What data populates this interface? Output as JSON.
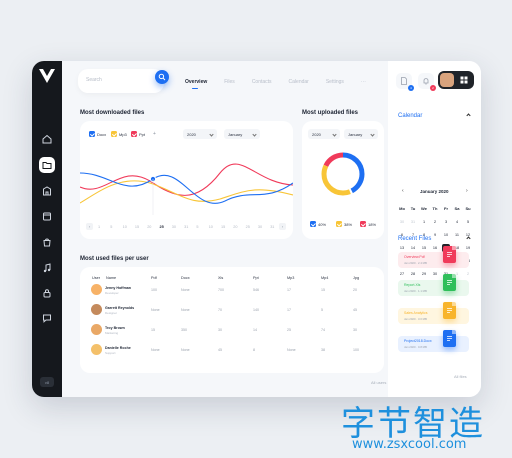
{
  "search": {
    "placeholder": "Search"
  },
  "tabs": [
    {
      "label": "Overview",
      "active": true
    },
    {
      "label": "Files",
      "active": false
    },
    {
      "label": "Contacts",
      "active": false
    },
    {
      "label": "Calendar",
      "active": false
    },
    {
      "label": "Settings",
      "active": false
    }
  ],
  "tabs_more": "···",
  "sidebar": {
    "items": [
      "home-icon",
      "folder-icon",
      "building-icon",
      "calendar-icon",
      "bag-icon",
      "music-icon",
      "lock-icon",
      "message-icon"
    ],
    "footer": "v8"
  },
  "downloaded": {
    "title": "Most downloaded files",
    "legend": [
      {
        "label": "Docx",
        "color": "#1e6ff2"
      },
      {
        "label": "Mp3",
        "color": "#f8c537"
      },
      {
        "label": "Ppt",
        "color": "#f03a5a"
      }
    ],
    "add": "+",
    "year": "2020",
    "month": "January",
    "x_labels": [
      "1",
      "5",
      "10",
      "15",
      "20",
      "25",
      "30",
      "31",
      "5",
      "10",
      "15",
      "20",
      "25",
      "30",
      "31"
    ],
    "prev": "‹",
    "next": "›"
  },
  "uploaded": {
    "title": "Most uploaded files",
    "year": "2020",
    "month": "January",
    "legend": [
      {
        "label": "40%",
        "color": "#1e6ff2",
        "value": 40
      },
      {
        "label": "38%",
        "color": "#f8c537",
        "value": 38
      },
      {
        "label": "18%",
        "color": "#f03a5a",
        "value": 18
      }
    ]
  },
  "users_table": {
    "title": "Most used files per user",
    "headers": [
      "User",
      "Name",
      "Pdf",
      "Docx",
      "Xls",
      "Ppt",
      "Mp3",
      "Mp4",
      "Jpg"
    ],
    "rows": [
      {
        "name": "Jenny Hoffman",
        "role": "Developer",
        "values": [
          "100",
          "None",
          "700",
          "546",
          "17",
          "15",
          "20"
        ],
        "color": "#f7b267"
      },
      {
        "name": "Garrett Reynolds",
        "role": "Designer",
        "values": [
          "None",
          "None",
          "70",
          "140",
          "17",
          "5",
          "45"
        ],
        "color": "#c48a5c"
      },
      {
        "name": "Troy Brown",
        "role": "Marketing",
        "values": [
          "15",
          "350",
          "30",
          "14",
          "25",
          "74",
          "30"
        ],
        "color": "#e9a866"
      },
      {
        "name": "Danielle Roche",
        "role": "Support",
        "values": [
          "None",
          "None",
          "45",
          "8",
          "None",
          "38",
          "100"
        ],
        "color": "#f4c06a"
      }
    ],
    "all_users": "All users",
    "all_users_arrow": "›"
  },
  "right": {
    "badges": [
      "4",
      "2"
    ],
    "calendar": {
      "title": "Calendar",
      "month": "January 2020",
      "prev": "‹",
      "next": "›",
      "dow": [
        "Mo",
        "Tu",
        "We",
        "Th",
        "Fr",
        "Sa",
        "Su"
      ],
      "weeks": [
        [
          "30",
          "31",
          "1",
          "2",
          "3",
          "4",
          "5"
        ],
        [
          "6",
          "7",
          "8",
          "9",
          "10",
          "11",
          "12"
        ],
        [
          "13",
          "14",
          "15",
          "16",
          "17",
          "18",
          "19"
        ],
        [
          "20",
          "21",
          "22",
          "23",
          "24",
          "25",
          "26"
        ],
        [
          "27",
          "28",
          "29",
          "30",
          "31",
          "1",
          "2"
        ]
      ],
      "selected_day": "17",
      "highlight_day": "25"
    },
    "recent": {
      "title": "Recent Files",
      "files": [
        {
          "name": "Overview.Pdf",
          "meta": "Jan 2020 · 2.4 MB",
          "color": "#f03a5a",
          "bg": "#fdecee",
          "icon": "pdf-icon"
        },
        {
          "name": "Report.Xls",
          "meta": "Jan 2020 · 1.1 MB",
          "color": "#2fbf5a",
          "bg": "#eaf8ee",
          "icon": "xls-icon"
        },
        {
          "name": "Sales Analytics",
          "meta": "Jan 2020 · 3.0 MB",
          "color": "#f8b42b",
          "bg": "#fff6e0",
          "icon": "doc-icon"
        },
        {
          "name": "Project2018.Docx",
          "meta": "Jan 2020 · 0.8 MB",
          "color": "#1e6ff2",
          "bg": "#e9f1ff",
          "icon": "docx-icon"
        }
      ],
      "all_files": "All files"
    }
  },
  "watermark": {
    "cn": "字节智造",
    "url": "www.zsxcool.com"
  }
}
